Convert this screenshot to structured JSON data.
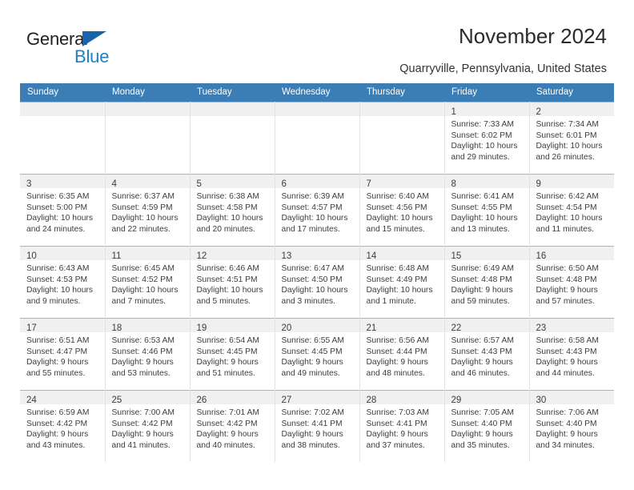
{
  "brand": {
    "name_top": "General",
    "name_bottom": "Blue",
    "accent_color": "#1f7fc4",
    "triangle_color": "#1565a8"
  },
  "header": {
    "title": "November 2024",
    "location": "Quarryville, Pennsylvania, United States",
    "header_bg": "#3b7db5",
    "daynum_band_bg": "#f0f0f0"
  },
  "calendar": {
    "weekday_headers": [
      "Sunday",
      "Monday",
      "Tuesday",
      "Wednesday",
      "Thursday",
      "Friday",
      "Saturday"
    ],
    "weeks": [
      [
        {
          "day": "",
          "sunrise": "",
          "sunset": "",
          "daylight": "",
          "daylight2": ""
        },
        {
          "day": "",
          "sunrise": "",
          "sunset": "",
          "daylight": "",
          "daylight2": ""
        },
        {
          "day": "",
          "sunrise": "",
          "sunset": "",
          "daylight": "",
          "daylight2": ""
        },
        {
          "day": "",
          "sunrise": "",
          "sunset": "",
          "daylight": "",
          "daylight2": ""
        },
        {
          "day": "",
          "sunrise": "",
          "sunset": "",
          "daylight": "",
          "daylight2": ""
        },
        {
          "day": "1",
          "sunrise": "Sunrise: 7:33 AM",
          "sunset": "Sunset: 6:02 PM",
          "daylight": "Daylight: 10 hours",
          "daylight2": "and 29 minutes."
        },
        {
          "day": "2",
          "sunrise": "Sunrise: 7:34 AM",
          "sunset": "Sunset: 6:01 PM",
          "daylight": "Daylight: 10 hours",
          "daylight2": "and 26 minutes."
        }
      ],
      [
        {
          "day": "3",
          "sunrise": "Sunrise: 6:35 AM",
          "sunset": "Sunset: 5:00 PM",
          "daylight": "Daylight: 10 hours",
          "daylight2": "and 24 minutes."
        },
        {
          "day": "4",
          "sunrise": "Sunrise: 6:37 AM",
          "sunset": "Sunset: 4:59 PM",
          "daylight": "Daylight: 10 hours",
          "daylight2": "and 22 minutes."
        },
        {
          "day": "5",
          "sunrise": "Sunrise: 6:38 AM",
          "sunset": "Sunset: 4:58 PM",
          "daylight": "Daylight: 10 hours",
          "daylight2": "and 20 minutes."
        },
        {
          "day": "6",
          "sunrise": "Sunrise: 6:39 AM",
          "sunset": "Sunset: 4:57 PM",
          "daylight": "Daylight: 10 hours",
          "daylight2": "and 17 minutes."
        },
        {
          "day": "7",
          "sunrise": "Sunrise: 6:40 AM",
          "sunset": "Sunset: 4:56 PM",
          "daylight": "Daylight: 10 hours",
          "daylight2": "and 15 minutes."
        },
        {
          "day": "8",
          "sunrise": "Sunrise: 6:41 AM",
          "sunset": "Sunset: 4:55 PM",
          "daylight": "Daylight: 10 hours",
          "daylight2": "and 13 minutes."
        },
        {
          "day": "9",
          "sunrise": "Sunrise: 6:42 AM",
          "sunset": "Sunset: 4:54 PM",
          "daylight": "Daylight: 10 hours",
          "daylight2": "and 11 minutes."
        }
      ],
      [
        {
          "day": "10",
          "sunrise": "Sunrise: 6:43 AM",
          "sunset": "Sunset: 4:53 PM",
          "daylight": "Daylight: 10 hours",
          "daylight2": "and 9 minutes."
        },
        {
          "day": "11",
          "sunrise": "Sunrise: 6:45 AM",
          "sunset": "Sunset: 4:52 PM",
          "daylight": "Daylight: 10 hours",
          "daylight2": "and 7 minutes."
        },
        {
          "day": "12",
          "sunrise": "Sunrise: 6:46 AM",
          "sunset": "Sunset: 4:51 PM",
          "daylight": "Daylight: 10 hours",
          "daylight2": "and 5 minutes."
        },
        {
          "day": "13",
          "sunrise": "Sunrise: 6:47 AM",
          "sunset": "Sunset: 4:50 PM",
          "daylight": "Daylight: 10 hours",
          "daylight2": "and 3 minutes."
        },
        {
          "day": "14",
          "sunrise": "Sunrise: 6:48 AM",
          "sunset": "Sunset: 4:49 PM",
          "daylight": "Daylight: 10 hours",
          "daylight2": "and 1 minute."
        },
        {
          "day": "15",
          "sunrise": "Sunrise: 6:49 AM",
          "sunset": "Sunset: 4:48 PM",
          "daylight": "Daylight: 9 hours",
          "daylight2": "and 59 minutes."
        },
        {
          "day": "16",
          "sunrise": "Sunrise: 6:50 AM",
          "sunset": "Sunset: 4:48 PM",
          "daylight": "Daylight: 9 hours",
          "daylight2": "and 57 minutes."
        }
      ],
      [
        {
          "day": "17",
          "sunrise": "Sunrise: 6:51 AM",
          "sunset": "Sunset: 4:47 PM",
          "daylight": "Daylight: 9 hours",
          "daylight2": "and 55 minutes."
        },
        {
          "day": "18",
          "sunrise": "Sunrise: 6:53 AM",
          "sunset": "Sunset: 4:46 PM",
          "daylight": "Daylight: 9 hours",
          "daylight2": "and 53 minutes."
        },
        {
          "day": "19",
          "sunrise": "Sunrise: 6:54 AM",
          "sunset": "Sunset: 4:45 PM",
          "daylight": "Daylight: 9 hours",
          "daylight2": "and 51 minutes."
        },
        {
          "day": "20",
          "sunrise": "Sunrise: 6:55 AM",
          "sunset": "Sunset: 4:45 PM",
          "daylight": "Daylight: 9 hours",
          "daylight2": "and 49 minutes."
        },
        {
          "day": "21",
          "sunrise": "Sunrise: 6:56 AM",
          "sunset": "Sunset: 4:44 PM",
          "daylight": "Daylight: 9 hours",
          "daylight2": "and 48 minutes."
        },
        {
          "day": "22",
          "sunrise": "Sunrise: 6:57 AM",
          "sunset": "Sunset: 4:43 PM",
          "daylight": "Daylight: 9 hours",
          "daylight2": "and 46 minutes."
        },
        {
          "day": "23",
          "sunrise": "Sunrise: 6:58 AM",
          "sunset": "Sunset: 4:43 PM",
          "daylight": "Daylight: 9 hours",
          "daylight2": "and 44 minutes."
        }
      ],
      [
        {
          "day": "24",
          "sunrise": "Sunrise: 6:59 AM",
          "sunset": "Sunset: 4:42 PM",
          "daylight": "Daylight: 9 hours",
          "daylight2": "and 43 minutes."
        },
        {
          "day": "25",
          "sunrise": "Sunrise: 7:00 AM",
          "sunset": "Sunset: 4:42 PM",
          "daylight": "Daylight: 9 hours",
          "daylight2": "and 41 minutes."
        },
        {
          "day": "26",
          "sunrise": "Sunrise: 7:01 AM",
          "sunset": "Sunset: 4:42 PM",
          "daylight": "Daylight: 9 hours",
          "daylight2": "and 40 minutes."
        },
        {
          "day": "27",
          "sunrise": "Sunrise: 7:02 AM",
          "sunset": "Sunset: 4:41 PM",
          "daylight": "Daylight: 9 hours",
          "daylight2": "and 38 minutes."
        },
        {
          "day": "28",
          "sunrise": "Sunrise: 7:03 AM",
          "sunset": "Sunset: 4:41 PM",
          "daylight": "Daylight: 9 hours",
          "daylight2": "and 37 minutes."
        },
        {
          "day": "29",
          "sunrise": "Sunrise: 7:05 AM",
          "sunset": "Sunset: 4:40 PM",
          "daylight": "Daylight: 9 hours",
          "daylight2": "and 35 minutes."
        },
        {
          "day": "30",
          "sunrise": "Sunrise: 7:06 AM",
          "sunset": "Sunset: 4:40 PM",
          "daylight": "Daylight: 9 hours",
          "daylight2": "and 34 minutes."
        }
      ]
    ]
  }
}
